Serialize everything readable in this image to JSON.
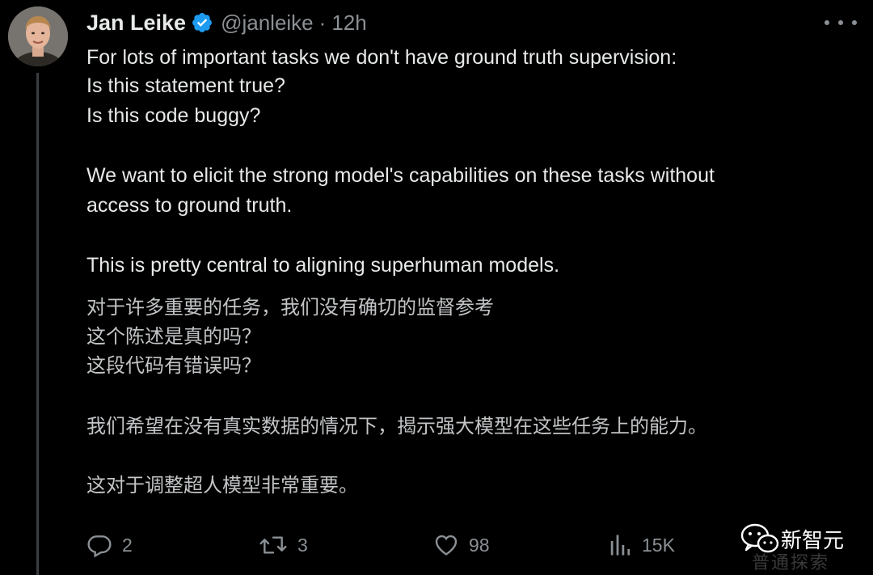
{
  "author": {
    "display_name": "Jan Leike",
    "handle": "@janleike",
    "separator": "·",
    "time": "12h",
    "verified_icon": "verified-badge-icon",
    "avatar": "profile-photo"
  },
  "body": {
    "lines": [
      "For lots of important tasks we don't have ground truth supervision:",
      "Is this statement true?",
      "Is this code buggy?",
      "We want to elicit the strong model's capabilities on these tasks without",
      "access to ground truth.",
      "This is pretty central to aligning superhuman models."
    ],
    "translation": [
      "对于许多重要的任务，我们没有确切的监督参考",
      "这个陈述是真的吗？",
      "这段代码有错误吗？",
      "我们希望在没有真实数据的情况下，揭示强大模型在这些任务上的能力。",
      "这对于调整超人模型非常重要。"
    ]
  },
  "actions": {
    "replies": "2",
    "retweets": "3",
    "likes": "98",
    "views": "15K"
  },
  "watermark": {
    "name": "新智元",
    "sub": "普通探索"
  },
  "colors": {
    "background": "#000000",
    "text": "#e7e9ea",
    "secondary": "#8b9095",
    "verified": "#1d9bf0"
  }
}
